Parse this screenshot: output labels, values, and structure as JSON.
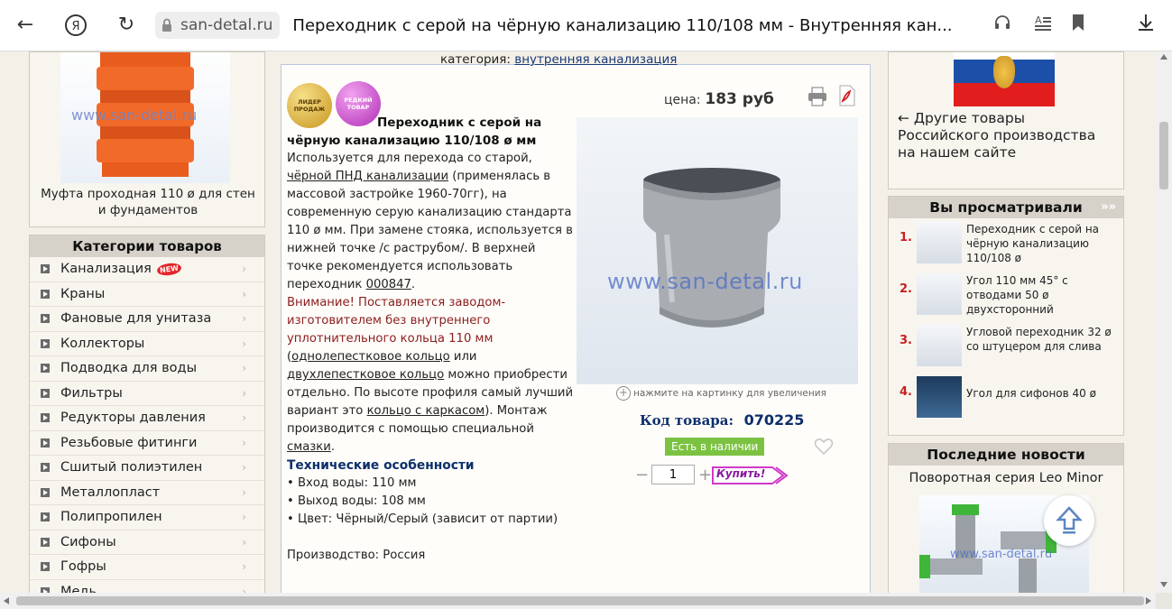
{
  "browser": {
    "domain": "san-detal.ru",
    "title": "Переходник с серой на чёрную канализацию 110/108 мм - Внутренняя кан..."
  },
  "breadcrumb": {
    "label": "категория:",
    "category": "внутренняя канализация"
  },
  "left_product": {
    "watermark": "www.san-detal.ru",
    "caption": "Муфта проходная 110 ø для стен и фундаментов"
  },
  "categories": {
    "title": "Категории товаров",
    "new_badge": "NEW",
    "items": [
      {
        "label": "Канализация"
      },
      {
        "label": "Краны"
      },
      {
        "label": "Фановые для унитаза"
      },
      {
        "label": "Коллекторы"
      },
      {
        "label": "Подводка для воды"
      },
      {
        "label": "Фильтры"
      },
      {
        "label": "Редукторы давления"
      },
      {
        "label": "Резьбовые фитинги"
      },
      {
        "label": "Сшитый полиэтилен"
      },
      {
        "label": "Металлопласт"
      },
      {
        "label": "Полипропилен"
      },
      {
        "label": "Сифоны"
      },
      {
        "label": "Гофры"
      },
      {
        "label": "Медь"
      }
    ]
  },
  "product": {
    "badge_leader": "ЛИДЕР ПРОДАЖ",
    "badge_rare": "РЕДКИЙ ТОВАР",
    "price_label": "цена:",
    "price": "183 руб",
    "title": "Переходник с серой на чёрную канализацию 110/108 ø мм",
    "d1": "Используется для перехода со старой,",
    "d1_link": "чёрной ПНД канализации",
    "d2": "(применялась в массовой застройке 1960-70гг), на современную серую канализацию стандарта 110 ø мм. При замене стояка, используется в нижней точке /с раструбом/. В верхней точке рекомендуется использовать переходник",
    "d2_link": "000847",
    "d2_end": ".",
    "warning": "Внимание! Поставляется заводом-изготовителем без внутреннего уплотнительного кольца 110 мм",
    "d3_open": "(",
    "d3_link1": "однолепестковое кольцо",
    "d3_or": "или",
    "d3_link2": "двухлепестковое кольцо",
    "d3_text": "можно приобрести отдельно. По высоте профиля самый лучший вариант это",
    "d3_link3": "кольцо с каркасом",
    "d3_text2": "). Монтаж производится с помощью специальной",
    "d3_link4": "смазки",
    "d3_end": ".",
    "specs_title": "Технические особенности",
    "specs": [
      "• Вход воды: 110 мм",
      "• Выход воды: 108 мм",
      "• Цвет: Чёрный/Серый (зависит от партии)"
    ],
    "production": "Производство: Россия",
    "image_watermark": "www.san-detal.ru",
    "zoom_hint": "нажмите на картинку для увеличения",
    "code_label": "Код товара:",
    "code": "070225",
    "availability": "Есть в наличии",
    "quantity": "1",
    "buy_label": "Купить!"
  },
  "right": {
    "other_goods": "← Другие товары Российского производства на нашем сайте",
    "viewed_title": "Вы просматривали",
    "viewed": [
      {
        "num": "1.",
        "text": "Переходник с серой на чёрную канализацию 110/108 ø"
      },
      {
        "num": "2.",
        "text": "Угол 110 мм 45° с отводами 50 ø двухсторонний"
      },
      {
        "num": "3.",
        "text": "Угловой переходник 32 ø со штуцером для слива"
      },
      {
        "num": "4.",
        "text": "Угол для сифонов 40 ø"
      }
    ],
    "news_title": "Последние новости",
    "news_item": "Поворотная серия Leo Minor",
    "news_watermark": "www.san-detal.ru"
  },
  "colors": {
    "accent_red": "#c62020",
    "link_blue": "#0d2f6b",
    "available_green": "#7cc242",
    "price_dark": "#333333"
  }
}
